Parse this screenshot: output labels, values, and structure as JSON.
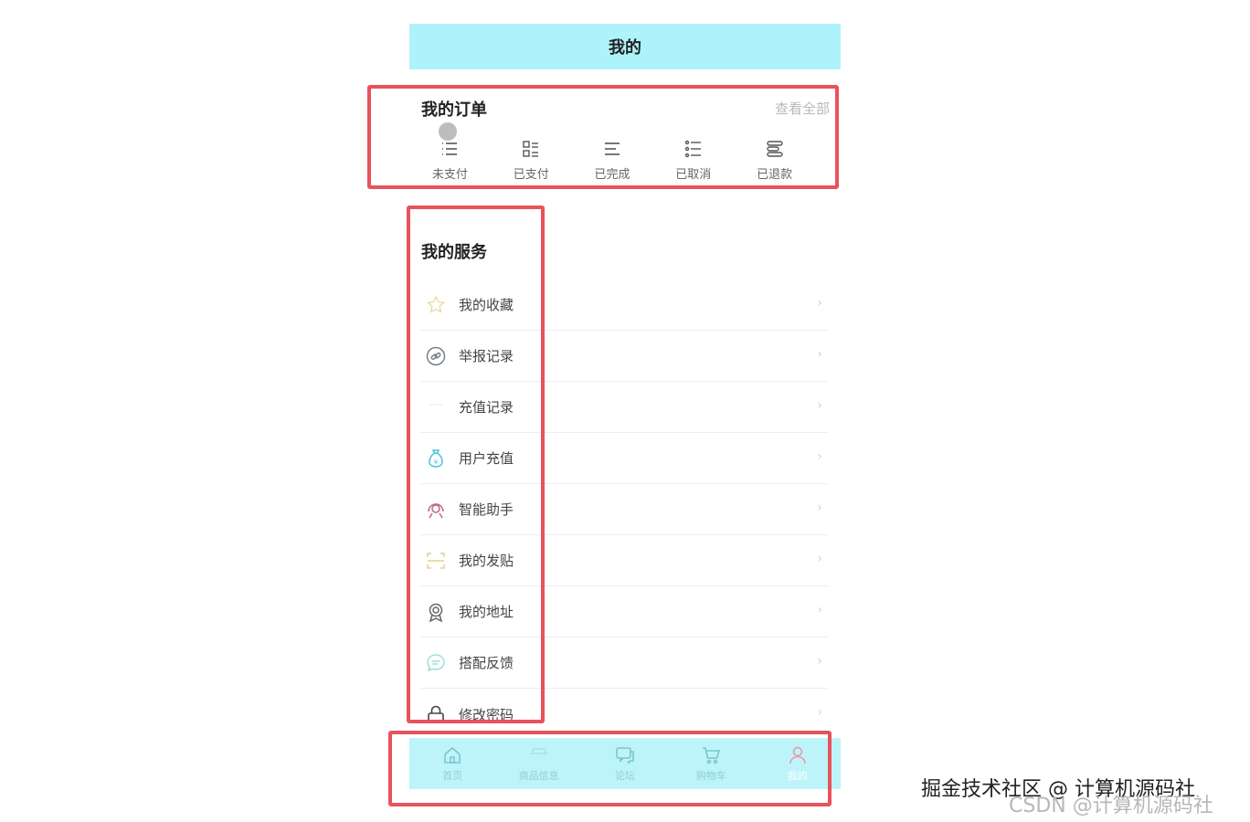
{
  "header": {
    "title": "我的"
  },
  "orders": {
    "title": "我的订单",
    "view_all": "查看全部",
    "items": [
      {
        "label": "未支付",
        "icon": "list-icon"
      },
      {
        "label": "已支付",
        "icon": "grid-list-icon"
      },
      {
        "label": "已完成",
        "icon": "lines-icon"
      },
      {
        "label": "已取消",
        "icon": "dot-list-icon"
      },
      {
        "label": "已退款",
        "icon": "stack-icon"
      }
    ]
  },
  "services": {
    "title": "我的服务",
    "items": [
      {
        "label": "我的收藏",
        "icon": "star-icon"
      },
      {
        "label": "举报记录",
        "icon": "link-icon"
      },
      {
        "label": "充值记录",
        "icon": "wallet-icon"
      },
      {
        "label": "用户充值",
        "icon": "money-bag-icon"
      },
      {
        "label": "智能助手",
        "icon": "headset-icon"
      },
      {
        "label": "我的发贴",
        "icon": "scan-frame-icon"
      },
      {
        "label": "我的地址",
        "icon": "badge-icon"
      },
      {
        "label": "搭配反馈",
        "icon": "chat-bubble-icon"
      },
      {
        "label": "修改密码",
        "icon": "lock-icon"
      }
    ],
    "chevron": "›"
  },
  "tabbar": {
    "items": [
      {
        "label": "首页",
        "icon": "home-icon"
      },
      {
        "label": "商品信息",
        "icon": "goods-icon"
      },
      {
        "label": "论坛",
        "icon": "forum-icon"
      },
      {
        "label": "购物车",
        "icon": "cart-icon"
      },
      {
        "label": "我的",
        "icon": "user-icon"
      }
    ]
  },
  "watermarks": {
    "line1": "掘金技术社区 @ 计算机源码社",
    "line2": "CSDN @计算机源码社"
  },
  "colors": {
    "header_bg": "#aef3fb",
    "tabbar_bg": "#bdf4f9",
    "highlight": "#e8525a"
  }
}
